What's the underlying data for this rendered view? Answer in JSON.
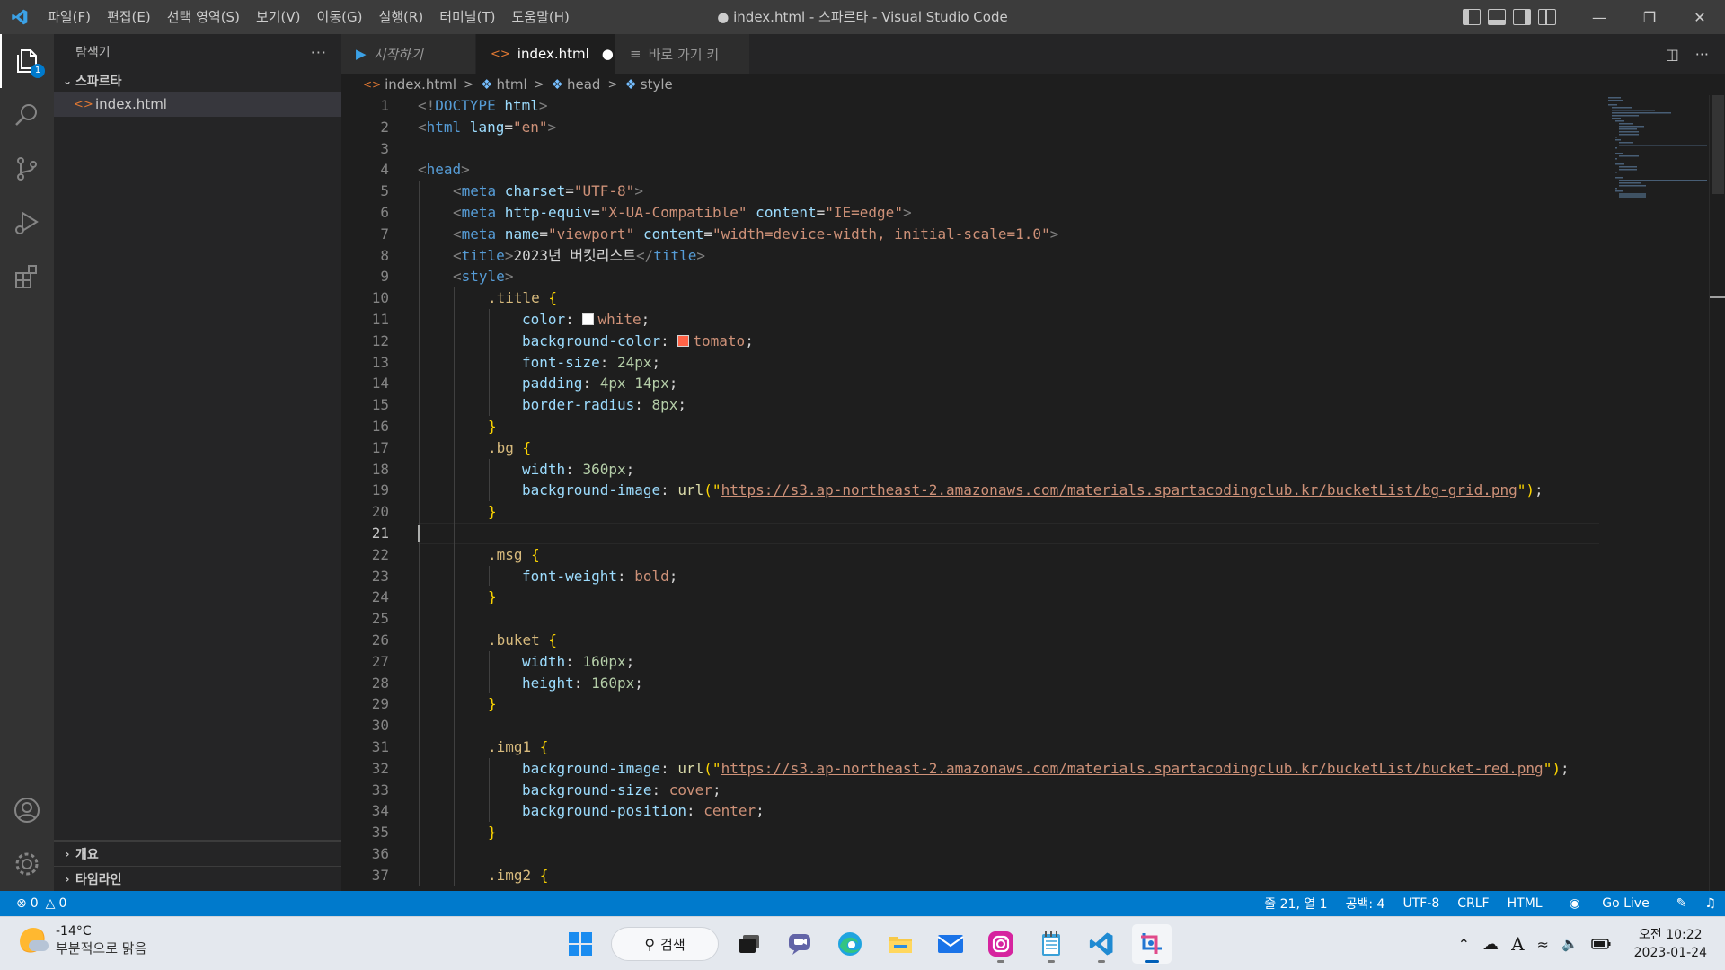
{
  "window": {
    "title": "● index.html - 스파르타 - Visual Studio Code"
  },
  "menu": [
    "파일(F)",
    "편집(E)",
    "선택 영역(S)",
    "보기(V)",
    "이동(G)",
    "실행(R)",
    "터미널(T)",
    "도움말(H)"
  ],
  "activity": {
    "explorer_badge": "1"
  },
  "sidebar": {
    "title": "탐색기",
    "more": "···",
    "folder": "스파르타",
    "files": [
      "index.html"
    ],
    "outline": "개요",
    "timeline": "타임라인"
  },
  "tabs": [
    {
      "label": "시작하기",
      "icon": "vscode-logo-icon"
    },
    {
      "label": "index.html",
      "icon": "html-file-icon",
      "dirty": "●"
    },
    {
      "label": "바로 가기 키",
      "icon": "keyboard-shortcuts-icon"
    }
  ],
  "breadcrumb": [
    "index.html",
    "html",
    "head",
    "style"
  ],
  "editor": {
    "line_numbers": [
      "1",
      "2",
      "3",
      "4",
      "5",
      "6",
      "7",
      "8",
      "9",
      "10",
      "11",
      "12",
      "13",
      "14",
      "15",
      "16",
      "17",
      "18",
      "19",
      "20",
      "21",
      "22",
      "23",
      "24",
      "25",
      "26",
      "27",
      "28",
      "29",
      "30",
      "31",
      "32",
      "33",
      "34",
      "35",
      "36",
      "37"
    ],
    "current_line": "21",
    "code": {
      "l1a": "<!",
      "l1b": "DOCTYPE",
      "l1c": " html",
      "l1d": ">",
      "l2a": "<",
      "l2b": "html",
      "l2c": " lang",
      "l2d": "=",
      "l2e": "\"en\"",
      "l2f": ">",
      "l4a": "<",
      "l4b": "head",
      "l4c": ">",
      "l5a": "<",
      "l5b": "meta",
      "l5c": " charset",
      "l5d": "=",
      "l5e": "\"UTF-8\"",
      "l5f": ">",
      "l6a": "<",
      "l6b": "meta",
      "l6c": " http-equiv",
      "l6d": "=",
      "l6e": "\"X-UA-Compatible\"",
      "l6f": " content",
      "l6g": "=",
      "l6h": "\"IE=edge\"",
      "l6i": ">",
      "l7a": "<",
      "l7b": "meta",
      "l7c": " name",
      "l7d": "=",
      "l7e": "\"viewport\"",
      "l7f": " content",
      "l7g": "=",
      "l7h": "\"width=device-width, initial-scale=1.0\"",
      "l7i": ">",
      "l8a": "<",
      "l8b": "title",
      "l8c": ">",
      "l8d": "2023년 버킷리스트",
      "l8e": "</",
      "l8f": "title",
      "l8g": ">",
      "l9a": "<",
      "l9b": "style",
      "l9c": ">",
      "l10a": ".title",
      "l10b": " {",
      "l11a": "color",
      "l11b": ": ",
      "l11c": "white",
      "l11d": ";",
      "l12a": "background-color",
      "l12b": ": ",
      "l12c": "tomato",
      "l12d": ";",
      "l13a": "font-size",
      "l13b": ": ",
      "l13c": "24px",
      "l13d": ";",
      "l14a": "padding",
      "l14b": ": ",
      "l14c": "4px 14px",
      "l14d": ";",
      "l15a": "border-radius",
      "l15b": ": ",
      "l15c": "8px",
      "l15d": ";",
      "l16a": "}",
      "l17a": ".bg",
      "l17b": " {",
      "l18a": "width",
      "l18b": ": ",
      "l18c": "360px",
      "l18d": ";",
      "l19a": "background-image",
      "l19b": ": ",
      "l19c": "url",
      "l19d": "(\"",
      "l19e": "https://s3.ap-northeast-2.amazonaws.com/materials.spartacodingclub.kr/bucketList/bg-grid.png",
      "l19f": "\")",
      "l19g": ";",
      "l20a": "}",
      "l22a": ".msg",
      "l22b": " {",
      "l23a": "font-weight",
      "l23b": ": ",
      "l23c": "bold",
      "l23d": ";",
      "l24a": "}",
      "l26a": ".buket",
      "l26b": " {",
      "l27a": "width",
      "l27b": ": ",
      "l27c": "160px",
      "l27d": ";",
      "l28a": "height",
      "l28b": ": ",
      "l28c": "160px",
      "l28d": ";",
      "l29a": "}",
      "l31a": ".img1",
      "l31b": " {",
      "l32a": "background-image",
      "l32b": ": ",
      "l32c": "url",
      "l32d": "(\"",
      "l32e": "https://s3.ap-northeast-2.amazonaws.com/materials.spartacodingclub.kr/bucketList/bucket-red.png",
      "l32f": "\")",
      "l32g": ";",
      "l33a": "background-size",
      "l33b": ": ",
      "l33c": "cover",
      "l33d": ";",
      "l34a": "background-position",
      "l34b": ": ",
      "l34c": "center",
      "l34d": ";",
      "l35a": "}",
      "l37a": ".img2",
      "l37b": " {"
    },
    "swatches": {
      "white": "#ffffff",
      "tomato": "#ff6347"
    }
  },
  "statusbar": {
    "errors": "0",
    "warnings": "0",
    "position": "줄 21, 열 1",
    "spaces": "공백: 4",
    "encoding": "UTF-8",
    "eol": "CRLF",
    "language": "HTML",
    "golive": "Go Live"
  },
  "taskbar": {
    "weather_temp": "-14°C",
    "weather_cond": "부분적으로 맑음",
    "search": "검색",
    "time": "오전 10:22",
    "date": "2023-01-24"
  },
  "colors": {
    "accent": "#007acc",
    "titlebar": "#3c3c3c",
    "editor_bg": "#1e1e1e",
    "sidebar_bg": "#252526"
  }
}
